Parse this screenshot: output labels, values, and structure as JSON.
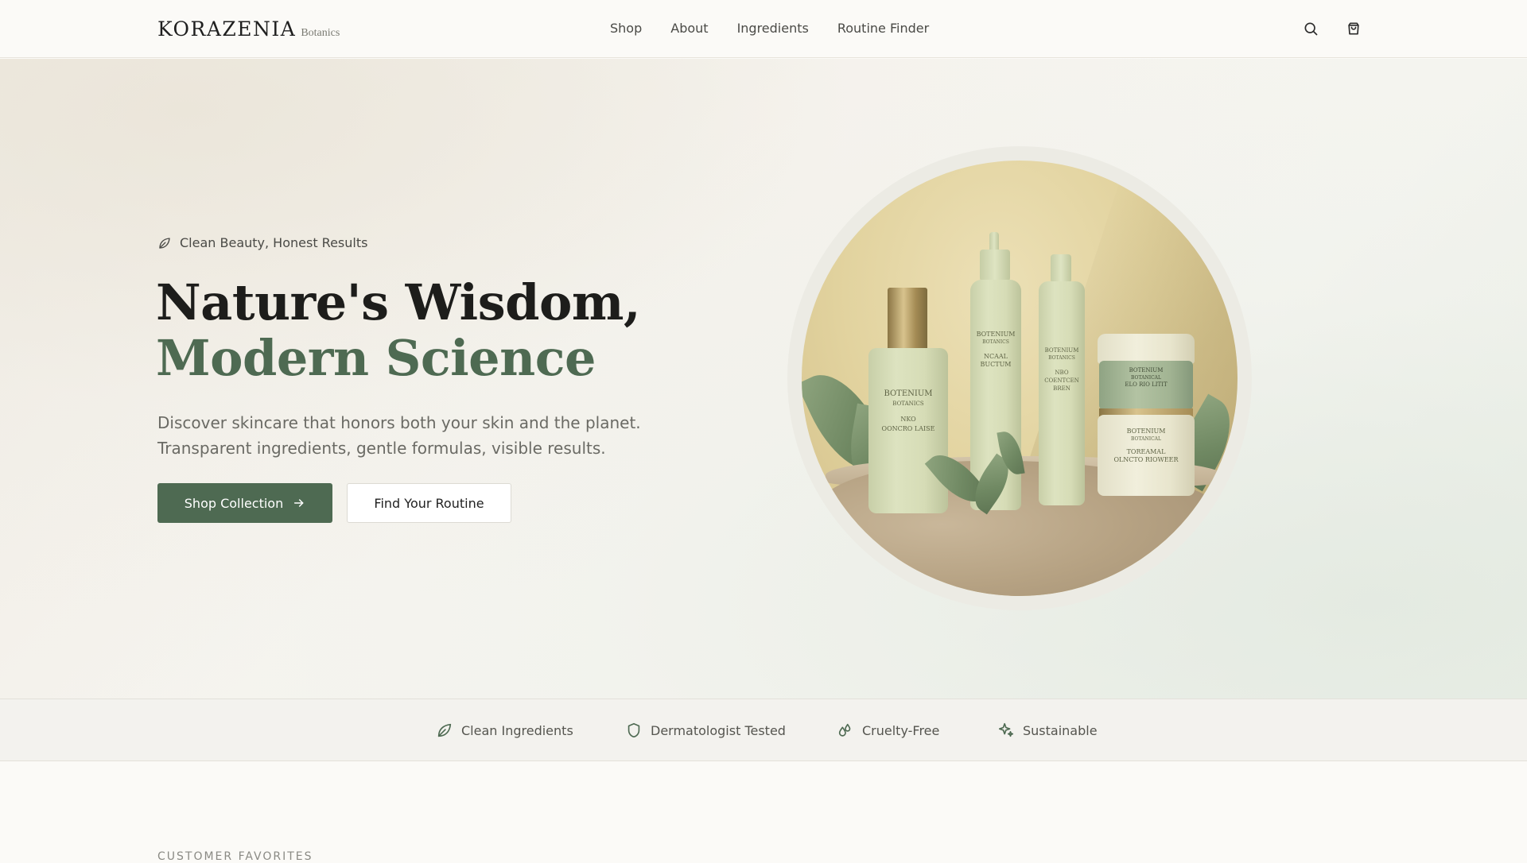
{
  "brand": {
    "name": "KORAZENIA",
    "sub": "Botanics"
  },
  "nav": {
    "items": [
      {
        "label": "Shop"
      },
      {
        "label": "About"
      },
      {
        "label": "Ingredients"
      },
      {
        "label": "Routine Finder"
      }
    ]
  },
  "header_icons": {
    "search": "search-icon",
    "cart": "shopping-bag-icon"
  },
  "hero": {
    "tagline": "Clean Beauty, Honest Results",
    "title_line1": "Nature's Wisdom,",
    "title_line2": "Modern Science",
    "description_line1": "Discover skincare that honors both your skin and the planet.",
    "description_line2": "Transparent ingredients, gentle formulas, visible results.",
    "primary_button": "Shop Collection",
    "secondary_button": "Find Your Routine",
    "image_alt": "Botanical skincare bottles and jars on a stone with sage leaves",
    "product_labels": {
      "bottle1_brand": "BOTENIUM",
      "bottle1_sub": "BOTANICS",
      "bottle1_name1": "NKO",
      "bottle1_name2": "OONCRO LAISE",
      "bottle2_brand": "BOTENIUM",
      "bottle2_sub": "BOTANICS",
      "bottle2_name1": "NCAAL",
      "bottle2_name2": "BUCTUM",
      "bottle3_brand": "BOTENIUM",
      "bottle3_sub": "BOTANICS",
      "bottle3_name1": "NBO",
      "bottle3_name2": "COENTCEN BREN",
      "jar1_brand": "BOTENIUM",
      "jar1_sub": "BOTANICAL",
      "jar1_name": "ELO RIO LITIT",
      "jar2_brand": "BOTENIUM",
      "jar2_sub": "BOTANICAL",
      "jar2_name1": "TOREAMAL",
      "jar2_name2": "OLNCTO RIOWEER"
    }
  },
  "features": [
    {
      "label": "Clean Ingredients",
      "icon": "leaf-icon"
    },
    {
      "label": "Dermatologist Tested",
      "icon": "shield-icon"
    },
    {
      "label": "Cruelty-Free",
      "icon": "droplets-icon"
    },
    {
      "label": "Sustainable",
      "icon": "sparkle-icon"
    }
  ],
  "next_section": {
    "label": "CUSTOMER FAVORITES"
  },
  "colors": {
    "accent": "#4e6a52",
    "background": "#fbfaf7",
    "text": "#1d1d1b"
  }
}
